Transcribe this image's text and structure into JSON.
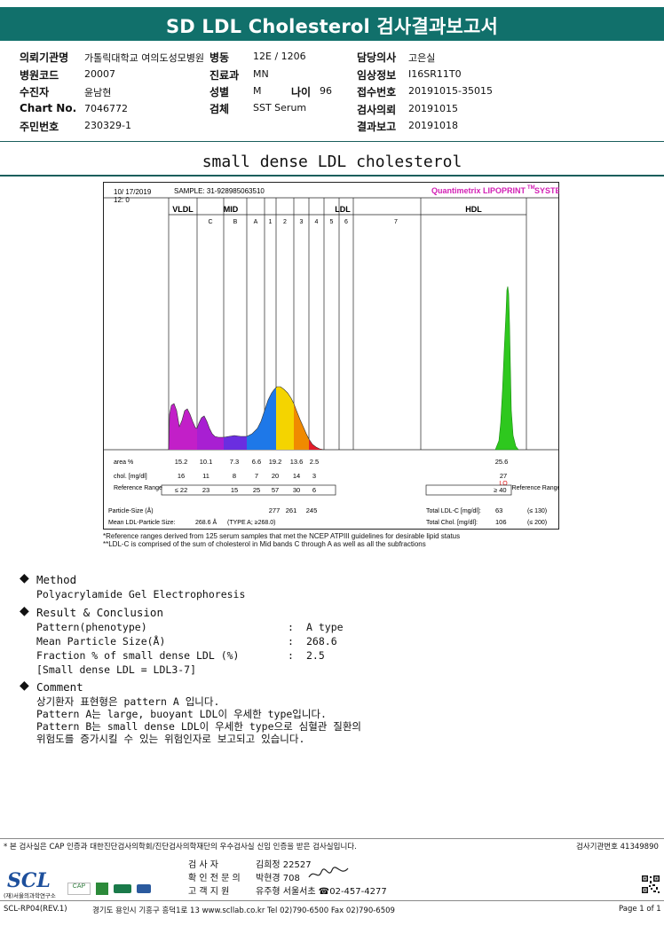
{
  "header": {
    "title": "SD LDL Cholesterol 검사결과보고서"
  },
  "info": {
    "institution_label": "의뢰기관명",
    "institution_value": "가톨릭대학교 여의도성모병원",
    "ward_label": "병동",
    "ward_value": "12E / 1206",
    "doctor_label": "담당의사",
    "doctor_value": "고은실",
    "hospital_code_label": "병원코드",
    "hospital_code_value": "20007",
    "department_label": "진료과",
    "department_value": "MN",
    "clinical_info_label": "임상정보",
    "clinical_info_value": "I16SR11T0",
    "patient_label": "수진자",
    "patient_value": "윤남현",
    "sex_label": "성별",
    "sex_value": "M",
    "age_label": "나이",
    "age_value": "96",
    "receipt_label": "접수번호",
    "receipt_value": "20191015-35015",
    "chart_no_label": "Chart No.",
    "chart_no_value": "7046772",
    "specimen_label": "검체",
    "specimen_value": "SST Serum",
    "request_label": "검사의뢰",
    "request_value": "20191015",
    "resident_label": "주민번호",
    "resident_value": "230329-1",
    "report_label": "결과보고",
    "report_value": "20191018"
  },
  "section_title": "small dense LDL cholesterol",
  "chart_data": {
    "type": "area",
    "date": "10/ 17/2019",
    "run": "12: 0",
    "sample": "SAMPLE: 31-928985063510",
    "brand": "Quantimetrix LIPOPRINT",
    "brand_tm": "TM",
    "brand_suffix": " SYSTEM",
    "groups": [
      "VLDL",
      "MID",
      "LDL",
      "HDL"
    ],
    "bands": [
      "C",
      "B",
      "A",
      "1",
      "2",
      "3",
      "4",
      "5",
      "6",
      "7"
    ],
    "row_area_label": "area %",
    "row_chol_label": "chol. [mg/dl]",
    "row_ref_label": "Reference Range",
    "area_pct": [
      "15.2",
      "10.1",
      "7.3",
      "6.6",
      "19.2",
      "13.6",
      "2.5"
    ],
    "chol": [
      "16",
      "11",
      "8",
      "7",
      "20",
      "14",
      "3"
    ],
    "ref_range": [
      "≤ 22",
      "23",
      "15",
      "25",
      "57",
      "30",
      "6"
    ],
    "hdl_area": "25.6",
    "hdl_chol": "27",
    "hdl_flag": "LO",
    "hdl_ref": "≥ 40",
    "ref_side_label": "Reference Range",
    "particle_size_label": "Particle-Size (Å)",
    "particle_sizes": [
      "277",
      "261",
      "245"
    ],
    "mean_ldl_label": "Mean LDL-Particle Size:",
    "mean_ldl_value": "268.6 Å",
    "mean_ldl_type": "(TYPE A; ≥268.0)",
    "total_ldl_label": "Total LDL-C [mg/dl]:",
    "total_ldl_value": "63",
    "total_ldl_ref": "(≤ 130)",
    "total_chol_label": "Total Chol. [mg/dl]:",
    "total_chol_value": "106",
    "total_chol_ref": "(≤ 200)",
    "footnote_1": "*Reference ranges derived from 125 serum samples that met the NCEP ATPIII guidelines for desirable lipid status",
    "footnote_2": "**LDL-C is comprised of the sum of cholesterol in Mid bands C through A as well as all the subfractions",
    "colors": {
      "vldl": "#c21fc8",
      "mid_c": "#a81fd2",
      "mid_b": "#6a2ee0",
      "mid_a": "#1e78e8",
      "ldl1": "#f4d400",
      "ldl2": "#f08a00",
      "ldl3": "#e41c2a",
      "ldl4": "#e0227a",
      "hdl": "#2ec81e",
      "brand": "#d21fb4",
      "flag": "#e01010"
    }
  },
  "method": {
    "heading": "Method",
    "text": "Polyacrylamide Gel Electrophoresis"
  },
  "result": {
    "heading": "Result & Conclusion",
    "rows": [
      {
        "label": "Pattern(phenotype)",
        "colon": ":",
        "value": "A type"
      },
      {
        "label": "Mean Particle Size(Å)",
        "colon": ":",
        "value": "268.6"
      },
      {
        "label": "Fraction % of small dense LDL (%)",
        "colon": ":",
        "value": "2.5"
      }
    ],
    "note": "[Small dense LDL = LDL3-7]"
  },
  "comment": {
    "heading": "Comment",
    "lines": [
      "상기환자 표현형은 pattern A 입니다.",
      "Pattern A는 large, buoyant LDL이 우세한 type입니다.",
      "Pattern B는 small dense LDL이 우세한 type으로 심혈관 질환의",
      "위험도를 증가시킬 수 있는 위험인자로 보고되고 있습니다."
    ]
  },
  "footer": {
    "notice": "* 본 검사실은 CAP 인증과 대한진단검사의학회/진단검사의학재단의 우수검사실 신임 인증을 받은 검사실입니다.",
    "lab_no": "검사기관번호 41349890",
    "tester_label": "검 사 자",
    "tester_value": "김희정 22527",
    "confirmer_label": "확 인 전 문 의",
    "confirmer_value": "박현경 708",
    "support_label": "고 객 지 원",
    "support_value": "유주형 서울서초 ☎02-457-4277",
    "logo_text": "SCL",
    "logo_sub": "(재)서울의과학연구소",
    "doc_code": "SCL-RP04(REV.1)",
    "address": "경기도 용인시 기흥구 흥덕1로 13   www.scllab.co.kr  Tel 02)790-6500  Fax 02)790-6509",
    "page": "Page 1 of 1"
  }
}
